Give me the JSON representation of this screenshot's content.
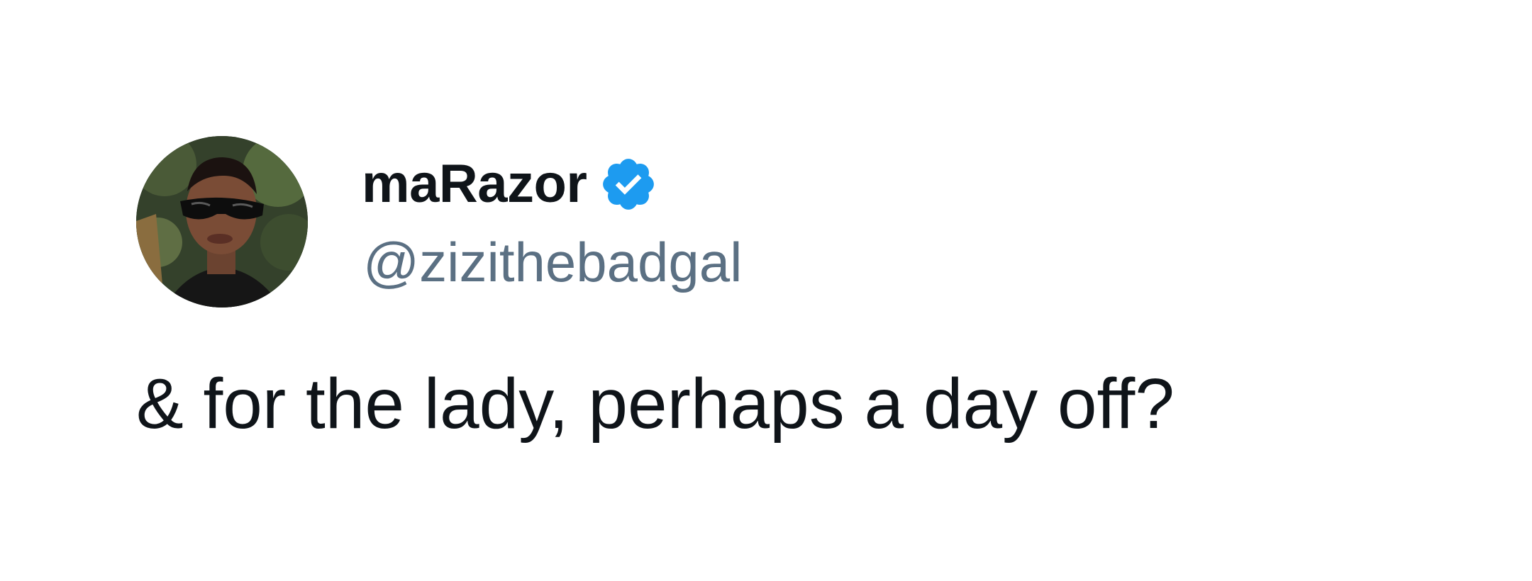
{
  "tweet": {
    "author": {
      "display_name": "maRazor",
      "handle": "@zizithebadgal",
      "verified": true,
      "avatar_icon": "profile-photo-woman-sunglasses"
    },
    "text": "& for the lady, perhaps a day off?"
  },
  "colors": {
    "background": "#ffffff",
    "name": "#0f1419",
    "handle": "#5b7083",
    "verified_badge": "#1d9bf0",
    "body_text": "#0f1419"
  }
}
